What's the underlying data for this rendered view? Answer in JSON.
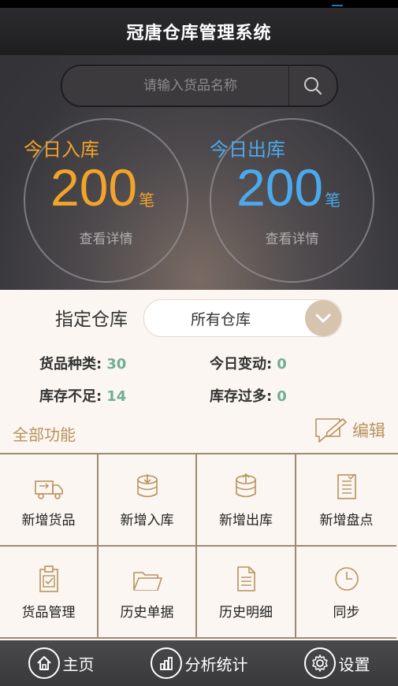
{
  "app": {
    "title": "冠唐仓库管理系统"
  },
  "search": {
    "placeholder": "请输入货品名称"
  },
  "stats": {
    "in": {
      "label": "今日入库",
      "value": "200",
      "unit": "笔",
      "detail": "查看详情"
    },
    "out": {
      "label": "今日出库",
      "value": "200",
      "unit": "笔",
      "detail": "查看详情"
    }
  },
  "warehouse": {
    "label": "指定仓库",
    "selected": "所有仓库"
  },
  "summary": {
    "types": {
      "label": "货品种类:",
      "value": "30"
    },
    "changes": {
      "label": "今日变动:",
      "value": "0"
    },
    "low": {
      "label": "库存不足:",
      "value": "14"
    },
    "high": {
      "label": "库存过多:",
      "value": "0"
    }
  },
  "functions": {
    "title": "全部功能",
    "edit": "编辑",
    "items": [
      {
        "label": "新增货品",
        "icon": "truck-icon"
      },
      {
        "label": "新增入库",
        "icon": "box-in-icon"
      },
      {
        "label": "新增出库",
        "icon": "box-out-icon"
      },
      {
        "label": "新增盘点",
        "icon": "checklist-icon"
      },
      {
        "label": "货品管理",
        "icon": "clipboard-check-icon"
      },
      {
        "label": "历史单据",
        "icon": "folder-icon"
      },
      {
        "label": "历史明细",
        "icon": "document-icon"
      },
      {
        "label": "同步",
        "icon": "clock-icon"
      }
    ]
  },
  "nav": {
    "home": "主页",
    "analytics": "分析统计",
    "settings": "设置"
  },
  "colors": {
    "in": "#f2a42a",
    "out": "#4ca9ee",
    "accent": "#b8925d",
    "value": "#6fae94"
  }
}
